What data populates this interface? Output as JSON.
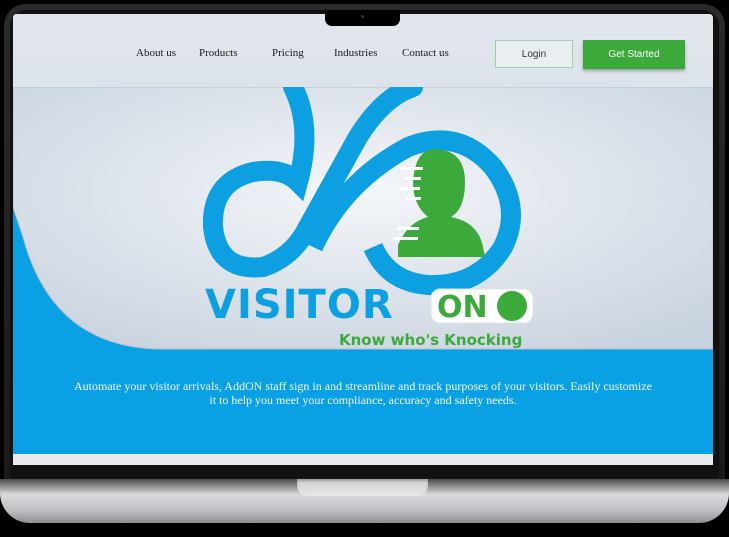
{
  "nav": {
    "items": [
      {
        "label": "About us"
      },
      {
        "label": "Products"
      },
      {
        "label": "Pricing"
      },
      {
        "label": "Industries"
      },
      {
        "label": "Contact us"
      }
    ],
    "login_label": "Login",
    "cta_label": "Get Started"
  },
  "hero": {
    "logo_word": "VISITOR",
    "logo_badge": "ON",
    "tagline": "Know who's Knocking",
    "description": "Automate your visitor arrivals, AddON staff sign in and streamline and track purposes of your visitors. Easily customize it to help you meet your compliance, accuracy and safety needs."
  },
  "colors": {
    "brand_blue": "#0aa0e4",
    "brand_green": "#3caa3a",
    "nav_bg": "#e2e7ee"
  },
  "icons": [
    "cloud-infinity-logo-icon",
    "person-silhouette-icon",
    "toggle-switch-icon"
  ]
}
